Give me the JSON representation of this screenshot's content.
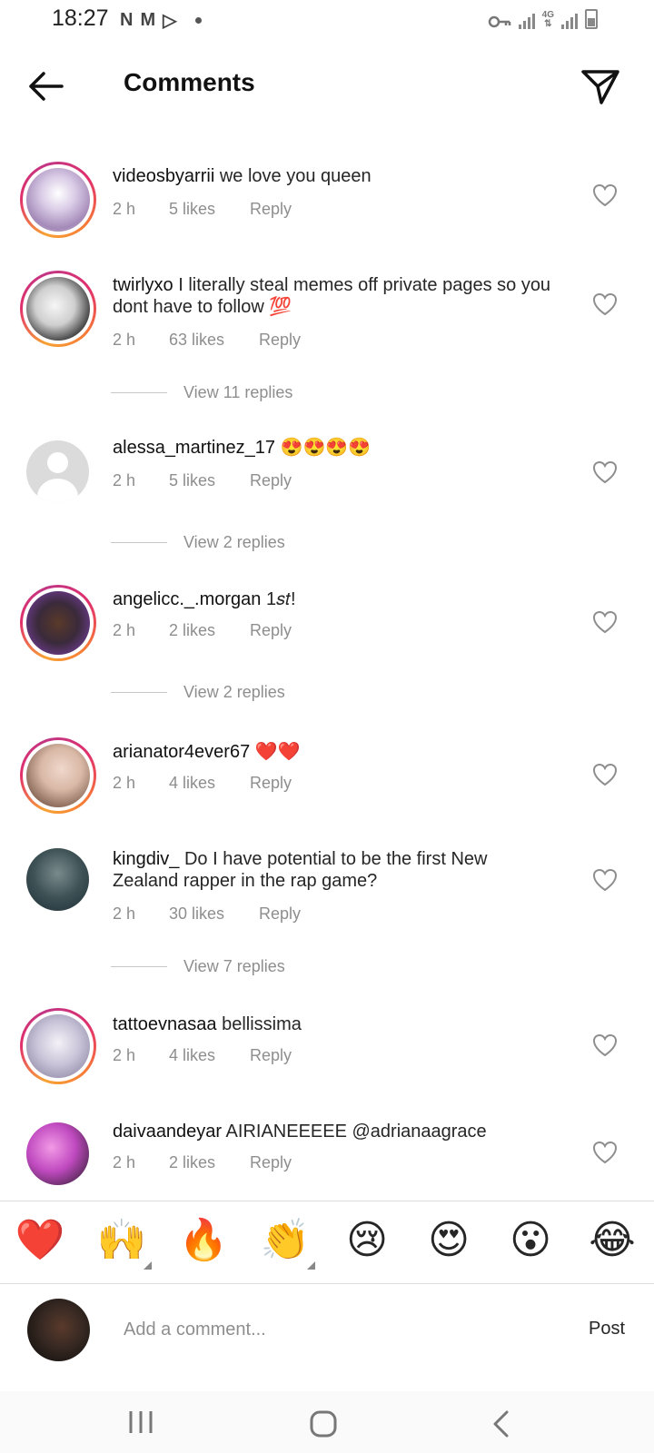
{
  "status_bar": {
    "time": "18:27",
    "left_icons": [
      "N",
      "M",
      "▷"
    ],
    "network": "4G",
    "icons": [
      "key-icon",
      "signal-icon",
      "battery-icon"
    ]
  },
  "header": {
    "title": "Comments",
    "back_icon": "arrow-left-icon",
    "send_icon": "send-icon"
  },
  "comments": [
    {
      "username": "videosbyarrii",
      "text": "we love you queen",
      "time": "2 h",
      "likes": "5 likes",
      "reply": "Reply"
    },
    {
      "username": "twirlyxo",
      "text": "I literally steal memes off private pages so you dont have to follow 💯",
      "time": "2 h",
      "likes": "63 likes",
      "reply": "Reply",
      "view_replies": "View 11 replies"
    },
    {
      "username": "alessa_martinez_17",
      "text": "😍😍😍😍",
      "time": "2 h",
      "likes": "5 likes",
      "reply": "Reply",
      "view_replies": "View 2 replies"
    },
    {
      "username": "angelicc._.morgan",
      "text": "1𝑠𝑡!",
      "time": "2 h",
      "likes": "2 likes",
      "reply": "Reply",
      "view_replies": "View 2 replies"
    },
    {
      "username": "arianator4ever67",
      "text": "❤️❤️",
      "time": "2 h",
      "likes": "4 likes",
      "reply": "Reply"
    },
    {
      "username": "kingdiv_",
      "text": "Do I have potential to be the first New Zealand rapper in the rap game?",
      "time": "2 h",
      "likes": "30 likes",
      "reply": "Reply",
      "view_replies": "View 7 replies"
    },
    {
      "username": "tattoevnasaa",
      "text": "bellissima",
      "time": "2 h",
      "likes": "4 likes",
      "reply": "Reply"
    },
    {
      "username": "daivaandeyar",
      "text": "AIRIANEEEEE @adrianaagrace",
      "time": "2 h",
      "likes": "2 likes",
      "reply": "Reply"
    }
  ],
  "emoji_bar": [
    "❤️",
    "🙌",
    "🔥",
    "👏",
    "😢",
    "😍",
    "😮",
    "😂"
  ],
  "composer": {
    "placeholder": "Add a comment...",
    "post_label": "Post"
  },
  "colors": {
    "story_ring": "#e1306c",
    "text_primary": "#262626",
    "text_secondary": "#8e8e8e",
    "divider": "#dbdbdb"
  }
}
